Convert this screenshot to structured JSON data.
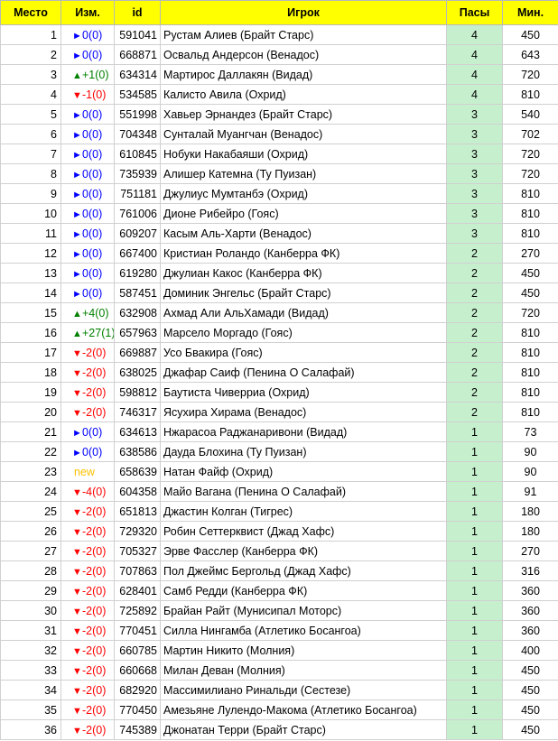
{
  "header": {
    "rank": "Место",
    "change": "Изм.",
    "id": "id",
    "player": "Игрок",
    "passes": "Пасы",
    "minutes": "Мин."
  },
  "colors": {
    "header_bg": "#ffff00",
    "passes_bg": "#c6efce",
    "same": "#0000ff",
    "up": "#008000",
    "down": "#ff0000",
    "new": "#ffc000"
  },
  "icons": {
    "same": "►",
    "up": "▲",
    "down": "▼"
  },
  "rows": [
    {
      "rank": "1",
      "dir": "same",
      "change": "0(0)",
      "id": "591041",
      "player": "Рустам Алиев (Брайт Старс)",
      "passes": "4",
      "minutes": "450"
    },
    {
      "rank": "2",
      "dir": "same",
      "change": "0(0)",
      "id": "668871",
      "player": "Освальд Андерсон (Венадос)",
      "passes": "4",
      "minutes": "643"
    },
    {
      "rank": "3",
      "dir": "up",
      "change": "+1(0)",
      "id": "634314",
      "player": "Мартирос Даллакян (Видад)",
      "passes": "4",
      "minutes": "720"
    },
    {
      "rank": "4",
      "dir": "down",
      "change": "-1(0)",
      "id": "534585",
      "player": "Калисто Авила (Охрид)",
      "passes": "4",
      "minutes": "810"
    },
    {
      "rank": "5",
      "dir": "same",
      "change": "0(0)",
      "id": "551998",
      "player": "Хавьер Эрнандез (Брайт Старс)",
      "passes": "3",
      "minutes": "540"
    },
    {
      "rank": "6",
      "dir": "same",
      "change": "0(0)",
      "id": "704348",
      "player": "Сунталай Муангчан (Венадос)",
      "passes": "3",
      "minutes": "702"
    },
    {
      "rank": "7",
      "dir": "same",
      "change": "0(0)",
      "id": "610845",
      "player": "Нобуки Накабаяши (Охрид)",
      "passes": "3",
      "minutes": "720"
    },
    {
      "rank": "8",
      "dir": "same",
      "change": "0(0)",
      "id": "735939",
      "player": "Алишер Катемна (Ту Пуизан)",
      "passes": "3",
      "minutes": "720"
    },
    {
      "rank": "9",
      "dir": "same",
      "change": "0(0)",
      "id": "751181",
      "player": "Джулиус Мумтанбэ (Охрид)",
      "passes": "3",
      "minutes": "810"
    },
    {
      "rank": "10",
      "dir": "same",
      "change": "0(0)",
      "id": "761006",
      "player": "Дионе Рибейро (Гояс)",
      "passes": "3",
      "minutes": "810"
    },
    {
      "rank": "11",
      "dir": "same",
      "change": "0(0)",
      "id": "609207",
      "player": "Касым Аль-Харти (Венадос)",
      "passes": "3",
      "minutes": "810"
    },
    {
      "rank": "12",
      "dir": "same",
      "change": "0(0)",
      "id": "667400",
      "player": "Кристиан Роландо (Канберра ФК)",
      "passes": "2",
      "minutes": "270"
    },
    {
      "rank": "13",
      "dir": "same",
      "change": "0(0)",
      "id": "619280",
      "player": "Джулиан Какос (Канберра ФК)",
      "passes": "2",
      "minutes": "450"
    },
    {
      "rank": "14",
      "dir": "same",
      "change": "0(0)",
      "id": "587451",
      "player": "Доминик Энгельс (Брайт Старс)",
      "passes": "2",
      "minutes": "450"
    },
    {
      "rank": "15",
      "dir": "up",
      "change": "+4(0)",
      "id": "632908",
      "player": "Ахмад Али АльХамади (Видад)",
      "passes": "2",
      "minutes": "720"
    },
    {
      "rank": "16",
      "dir": "up",
      "change": "+27(1)",
      "id": "657963",
      "player": "Марсело Моргадо (Гояс)",
      "passes": "2",
      "minutes": "810"
    },
    {
      "rank": "17",
      "dir": "down",
      "change": "-2(0)",
      "id": "669887",
      "player": "Усо Бвакира (Гояс)",
      "passes": "2",
      "minutes": "810"
    },
    {
      "rank": "18",
      "dir": "down",
      "change": "-2(0)",
      "id": "638025",
      "player": "Джафар Саиф (Пенина О Салафай)",
      "passes": "2",
      "minutes": "810"
    },
    {
      "rank": "19",
      "dir": "down",
      "change": "-2(0)",
      "id": "598812",
      "player": "Баутиста Чиверриа (Охрид)",
      "passes": "2",
      "minutes": "810"
    },
    {
      "rank": "20",
      "dir": "down",
      "change": "-2(0)",
      "id": "746317",
      "player": "Ясухира Хирама (Венадос)",
      "passes": "2",
      "minutes": "810"
    },
    {
      "rank": "21",
      "dir": "same",
      "change": "0(0)",
      "id": "634613",
      "player": "Нжарасоа Раджанаривони (Видад)",
      "passes": "1",
      "minutes": "73"
    },
    {
      "rank": "22",
      "dir": "same",
      "change": "0(0)",
      "id": "638586",
      "player": "Дауда Блохина (Ту Пуизан)",
      "passes": "1",
      "minutes": "90"
    },
    {
      "rank": "23",
      "dir": "new",
      "change": "new",
      "id": "658639",
      "player": "Натан Файф (Охрид)",
      "passes": "1",
      "minutes": "90"
    },
    {
      "rank": "24",
      "dir": "down",
      "change": "-4(0)",
      "id": "604358",
      "player": "Майо Вагана (Пенина О Салафай)",
      "passes": "1",
      "minutes": "91"
    },
    {
      "rank": "25",
      "dir": "down",
      "change": "-2(0)",
      "id": "651813",
      "player": "Джастин Колган (Тигрес)",
      "passes": "1",
      "minutes": "180"
    },
    {
      "rank": "26",
      "dir": "down",
      "change": "-2(0)",
      "id": "729320",
      "player": "Робин Сеттерквист (Джад Хафс)",
      "passes": "1",
      "minutes": "180"
    },
    {
      "rank": "27",
      "dir": "down",
      "change": "-2(0)",
      "id": "705327",
      "player": "Эрве Фасслер (Канберра ФК)",
      "passes": "1",
      "minutes": "270"
    },
    {
      "rank": "28",
      "dir": "down",
      "change": "-2(0)",
      "id": "707863",
      "player": "Пол Джеймс Бергольд (Джад Хафс)",
      "passes": "1",
      "minutes": "316"
    },
    {
      "rank": "29",
      "dir": "down",
      "change": "-2(0)",
      "id": "628401",
      "player": "Самб Редди (Канберра ФК)",
      "passes": "1",
      "minutes": "360"
    },
    {
      "rank": "30",
      "dir": "down",
      "change": "-2(0)",
      "id": "725892",
      "player": "Брайан Райт (Мунисипал Моторс)",
      "passes": "1",
      "minutes": "360"
    },
    {
      "rank": "31",
      "dir": "down",
      "change": "-2(0)",
      "id": "770451",
      "player": "Силла Нингамба (Атлетико Босангоа)",
      "passes": "1",
      "minutes": "360"
    },
    {
      "rank": "32",
      "dir": "down",
      "change": "-2(0)",
      "id": "660785",
      "player": "Мартин Никито (Молния)",
      "passes": "1",
      "minutes": "400"
    },
    {
      "rank": "33",
      "dir": "down",
      "change": "-2(0)",
      "id": "660668",
      "player": "Милан Деван (Молния)",
      "passes": "1",
      "minutes": "450"
    },
    {
      "rank": "34",
      "dir": "down",
      "change": "-2(0)",
      "id": "682920",
      "player": "Массимилиано Ринальди (Сестезе)",
      "passes": "1",
      "minutes": "450"
    },
    {
      "rank": "35",
      "dir": "down",
      "change": "-2(0)",
      "id": "770450",
      "player": "Амезьяне Лулендо-Макома (Атлетико Босангоа)",
      "passes": "1",
      "minutes": "450"
    },
    {
      "rank": "36",
      "dir": "down",
      "change": "-2(0)",
      "id": "745389",
      "player": "Джонатан Терри (Брайт Старс)",
      "passes": "1",
      "minutes": "450"
    }
  ]
}
